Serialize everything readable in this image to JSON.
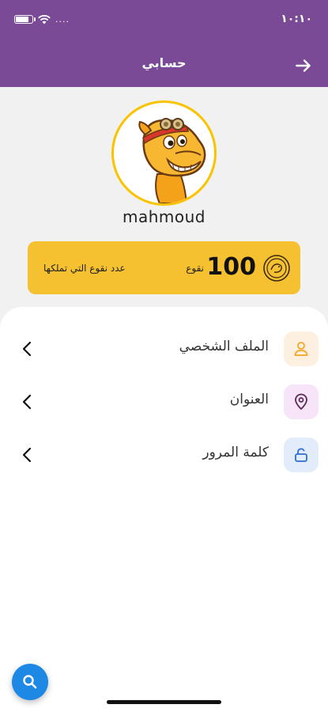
{
  "status_bar": {
    "carrier": "....",
    "time": "١٠:١٠",
    "battery_level": 0.8
  },
  "app_bar": {
    "title": "حسابي",
    "back_icon": "arrow-right-icon"
  },
  "profile": {
    "avatar_icon": "camel-mascot-icon",
    "username": "mahmoud"
  },
  "points_card": {
    "value": "100",
    "unit": "نقوع",
    "description": "عدد نقوع التي تملكها",
    "icon": "coin-icon",
    "color": "#f6c130"
  },
  "menu": {
    "items": [
      {
        "label": "الملف الشخصي",
        "icon": "user-icon",
        "icon_bg": "#fdf0e1",
        "icon_color": "#f5a623"
      },
      {
        "label": "العنوان",
        "icon": "location-pin-icon",
        "icon_bg": "#f8e4f8",
        "icon_color": "#5a2a5a"
      },
      {
        "label": "كلمة المرور",
        "icon": "lock-icon",
        "icon_bg": "#e3ecfb",
        "icon_color": "#2f6fd1"
      }
    ]
  },
  "fab": {
    "icon": "search-icon",
    "color": "#1e88e5"
  },
  "theme": {
    "primary": "#7a4a97",
    "accent": "#f9c300"
  }
}
